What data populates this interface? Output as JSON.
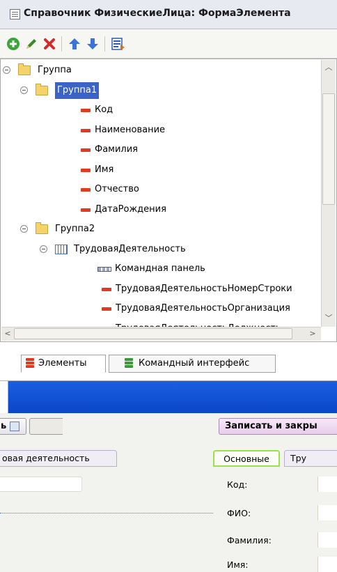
{
  "window": {
    "title": "Справочник ФизическиеЛица: ФормаЭлемента"
  },
  "toolbar": {
    "buttons": [
      {
        "name": "add",
        "icon": "plus-circle-icon",
        "color": "#3aa63a"
      },
      {
        "name": "edit",
        "icon": "pencil-icon",
        "color": "#3a8a2a"
      },
      {
        "name": "delete",
        "icon": "cross-icon",
        "color": "#d22b2b"
      },
      {
        "name": "move-up",
        "icon": "arrow-up-icon",
        "color": "#3b73d6"
      },
      {
        "name": "move-down",
        "icon": "arrow-down-icon",
        "color": "#3b73d6"
      },
      {
        "name": "form-properties",
        "icon": "form-icon",
        "color": "#2b5bb8"
      }
    ]
  },
  "tree": {
    "items": [
      {
        "label": "Группа",
        "type": "folder"
      },
      {
        "label": "Группа1",
        "type": "folder",
        "selected": true
      },
      {
        "label": "Код",
        "type": "field"
      },
      {
        "label": "Наименование",
        "type": "field"
      },
      {
        "label": "Фамилия",
        "type": "field"
      },
      {
        "label": "Имя",
        "type": "field"
      },
      {
        "label": "Отчество",
        "type": "field"
      },
      {
        "label": "ДатаРождения",
        "type": "field"
      },
      {
        "label": "Группа2",
        "type": "folder"
      },
      {
        "label": "ТрудоваяДеятельность",
        "type": "table"
      },
      {
        "label": "Командная панель",
        "type": "command-panel"
      },
      {
        "label": "ТрудоваяДеятельностьНомерСтроки",
        "type": "field"
      },
      {
        "label": "ТрудоваяДеятельностьОрганизация",
        "type": "field"
      },
      {
        "label": "ТрудоваяДеятельностьДолжность",
        "type": "field"
      }
    ]
  },
  "tabs": {
    "elements": "Элементы",
    "command_interface": "Командный интерфейс"
  },
  "preview": {
    "left_button_fragment": "ь",
    "save_close": "Записать и закры",
    "tab_work_fragment": "овая деятельность",
    "tab_main": "Основные",
    "tab_right_fragment": "Тру",
    "fields": {
      "code": "Код:",
      "fio": "ФИО:",
      "surname": "Фамилия:",
      "name": "Имя:"
    }
  },
  "colors": {
    "selection": "#3b63c7",
    "field_marker": "#e23a1e",
    "folder": "#f3d36a",
    "preview_bar": "#1a5fe0",
    "active_tab_border": "#9be24a"
  }
}
